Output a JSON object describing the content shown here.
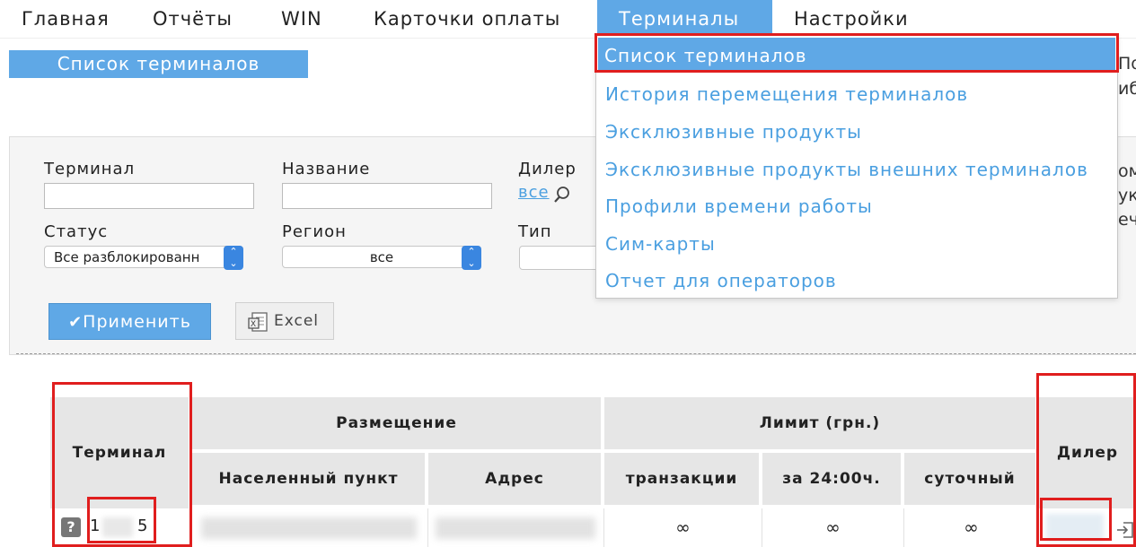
{
  "nav": {
    "items": [
      "Главная",
      "Отчёты",
      "WIN",
      "Карточки оплаты",
      "Терминалы",
      "Настройки"
    ],
    "active": "Терминалы"
  },
  "subheader": {
    "title": "Список терминалов"
  },
  "edge_text": [
    "По",
    "иб",
    "ом",
    "ук",
    "еч"
  ],
  "dropdown": {
    "items": [
      "Список терминалов",
      "История перемещения терминалов",
      "Эксклюзивные продукты",
      "Эксклюзивные продукты внешних терминалов",
      "Профили времени работы",
      "Сим-карты",
      "Отчет для операторов"
    ]
  },
  "filters": {
    "terminal_label": "Терминал",
    "name_label": "Название",
    "dealer_label": "Дилер",
    "dealer_link": "все",
    "status_label": "Статус",
    "status_value": "Все разблокированн",
    "region_label": "Регион",
    "region_value": "все",
    "type_label": "Тип"
  },
  "buttons": {
    "apply": "Применить",
    "excel": "Excel"
  },
  "table": {
    "terminal_header": "Терминал",
    "placement_header": "Размещение",
    "limit_header": "Лимит (грн.)",
    "dealer_header": "Дилер",
    "sub_headers": [
      "Населенный пункт",
      "Адрес",
      "транзакции",
      "за 24:00ч.",
      "суточный"
    ],
    "row": {
      "help_badge": "?",
      "terminal_id_start": "1",
      "terminal_id_end": "5",
      "transactions_limit": "∞",
      "daily_24h_limit": "∞",
      "daily_limit": "∞"
    }
  },
  "colors": {
    "accent": "#5fa8e6",
    "link": "#4a9fe0",
    "highlight": "#e01e1e"
  }
}
